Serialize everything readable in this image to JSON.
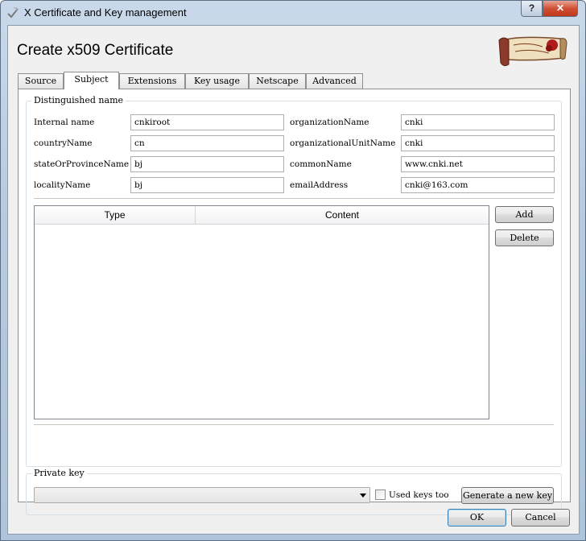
{
  "window": {
    "title": "X Certificate and Key management",
    "help_label": "?",
    "close_label": "✕"
  },
  "dialog": {
    "heading": "Create x509 Certificate"
  },
  "tabs": [
    {
      "label": "Source",
      "active": false
    },
    {
      "label": "Subject",
      "active": true
    },
    {
      "label": "Extensions",
      "active": false
    },
    {
      "label": "Key usage",
      "active": false
    },
    {
      "label": "Netscape",
      "active": false
    },
    {
      "label": "Advanced",
      "active": false
    }
  ],
  "distinguished": {
    "title": "Distinguished name",
    "rows": [
      {
        "label_left": "Internal name",
        "value_left": "cnkiroot",
        "label_right": "organizationName",
        "value_right": "cnki"
      },
      {
        "label_left": "countryName",
        "value_left": "cn",
        "label_right": "organizationalUnitName",
        "value_right": "cnki"
      },
      {
        "label_left": "stateOrProvinceName",
        "value_left": "bj",
        "label_right": "commonName",
        "value_right": "www.cnki.net"
      },
      {
        "label_left": "localityName",
        "value_left": "bj",
        "label_right": "emailAddress",
        "value_right": "cnki@163.com"
      }
    ]
  },
  "table": {
    "headers": [
      "Type",
      "Content"
    ]
  },
  "side_buttons": {
    "add": "Add",
    "delete": "Delete"
  },
  "private_key": {
    "title": "Private key",
    "selected": "",
    "used_keys_label": "Used keys too",
    "generate_label": "Generate a new key"
  },
  "footer": {
    "ok": "OK",
    "cancel": "Cancel"
  }
}
